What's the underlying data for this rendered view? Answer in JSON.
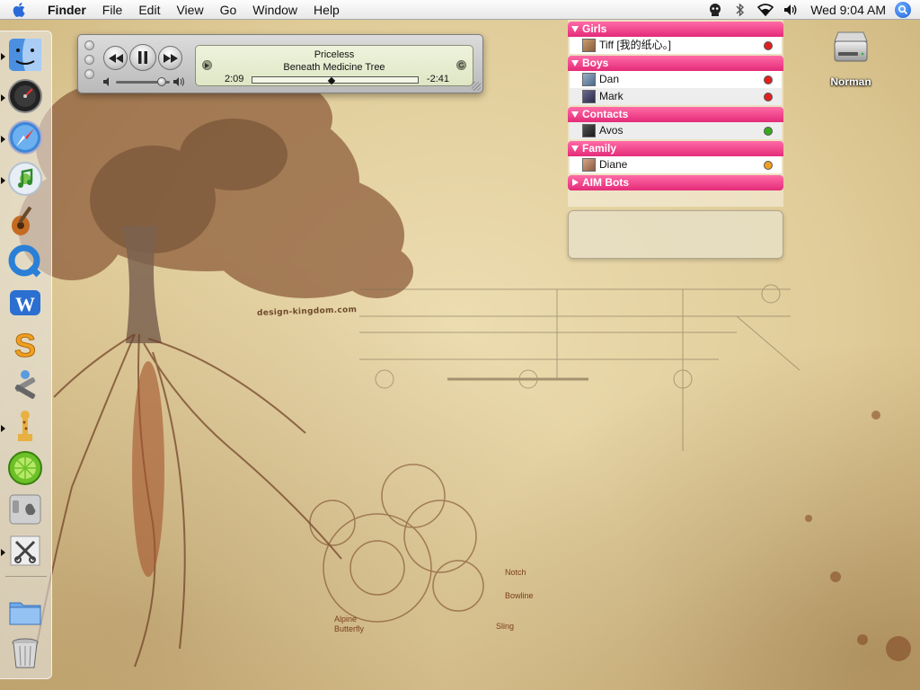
{
  "menubar": {
    "app_name": "Finder",
    "items": [
      "File",
      "Edit",
      "View",
      "Go",
      "Window",
      "Help"
    ],
    "clock": "Wed 9:04 AM",
    "status_icons": [
      "script-menu-icon",
      "bluetooth-icon",
      "airport-icon",
      "volume-icon"
    ]
  },
  "dock": {
    "items": [
      {
        "name": "finder",
        "running": true
      },
      {
        "name": "dashboard",
        "running": true
      },
      {
        "name": "safari",
        "running": true
      },
      {
        "name": "itunes",
        "running": true
      },
      {
        "name": "garageband",
        "running": false
      },
      {
        "name": "quicktime",
        "running": false
      },
      {
        "name": "word",
        "running": false
      },
      {
        "name": "s-app",
        "running": false
      },
      {
        "name": "utility",
        "running": false
      },
      {
        "name": "giraffe-app",
        "running": true
      },
      {
        "name": "limewire",
        "running": false
      },
      {
        "name": "system-preferences",
        "running": false
      },
      {
        "name": "tool-app",
        "running": true
      },
      {
        "name": "documents-folder",
        "running": false
      },
      {
        "name": "trash",
        "running": false
      }
    ]
  },
  "itunes": {
    "title": "Priceless",
    "artist": "Beneath Medicine Tree",
    "elapsed": "2:09",
    "remaining": "-2:41",
    "progress": 0.47,
    "volume": 0.85
  },
  "buddylist": {
    "groups": [
      {
        "name": "Girls",
        "expanded": true,
        "buddies": [
          {
            "name": "Tiff [我的纸心。]",
            "status": "red"
          }
        ]
      },
      {
        "name": "Boys",
        "expanded": true,
        "buddies": [
          {
            "name": "Dan",
            "status": "red"
          },
          {
            "name": "Mark",
            "status": "red"
          }
        ]
      },
      {
        "name": "Contacts",
        "expanded": true,
        "buddies": [
          {
            "name": "Avos",
            "status": "green"
          }
        ]
      },
      {
        "name": "Family",
        "expanded": true,
        "buddies": [
          {
            "name": "Diane",
            "status": "orange"
          }
        ]
      },
      {
        "name": "AIM Bots",
        "expanded": false,
        "buddies": []
      }
    ],
    "status_colors": {
      "red": "#e02020",
      "green": "#3aa81e",
      "orange": "#f0a020"
    },
    "header_color": "#e42b79"
  },
  "desktop": {
    "drive_label": "Norman",
    "wallpaper_credit": "design-kingdom.com",
    "sketch_labels": [
      "Notch",
      "Bowline",
      "Sling",
      "Alpine Butterfly"
    ]
  }
}
